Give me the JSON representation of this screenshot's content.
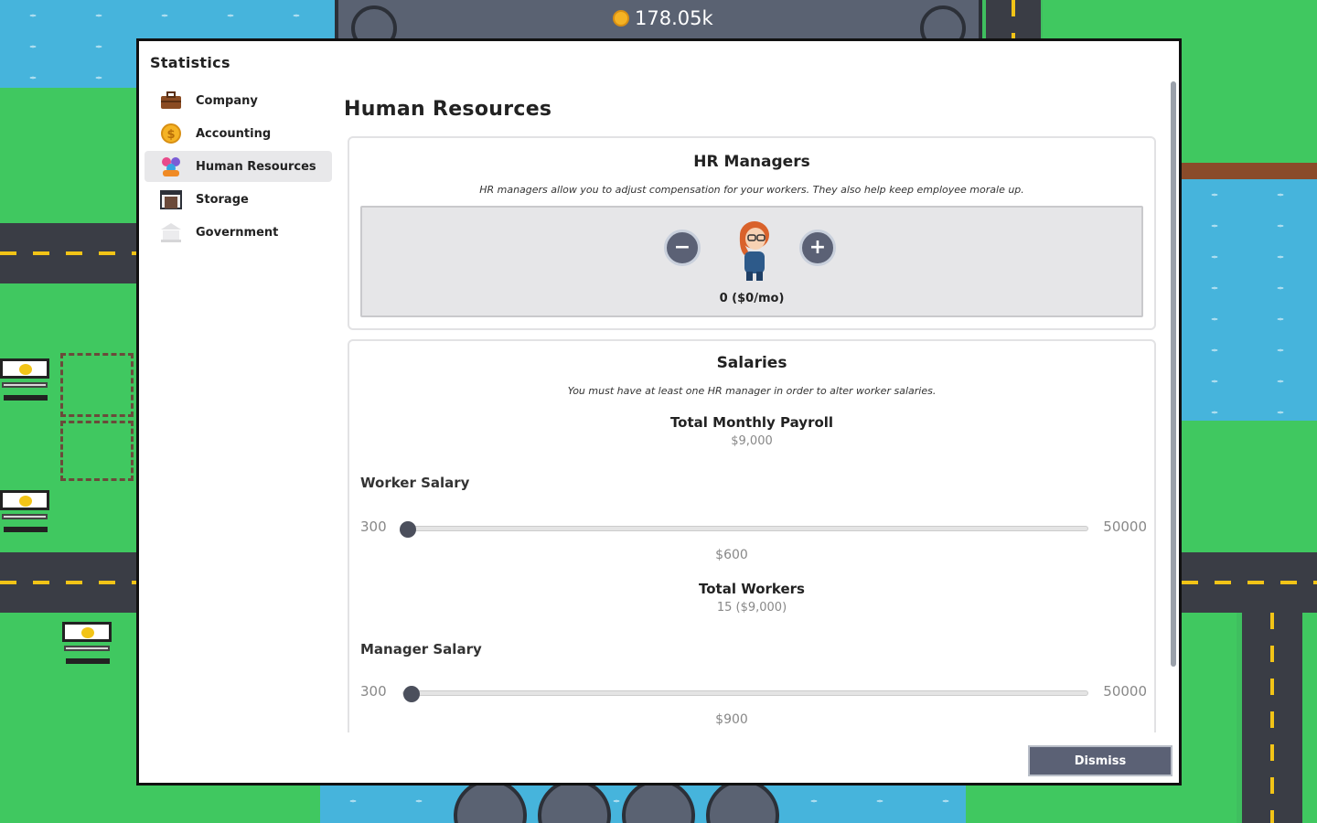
{
  "hud": {
    "money": "178.05k"
  },
  "modal": {
    "title": "Statistics",
    "nav": [
      {
        "label": "Company",
        "icon": "briefcase-icon"
      },
      {
        "label": "Accounting",
        "icon": "coin-icon"
      },
      {
        "label": "Human Resources",
        "icon": "people-icon",
        "active": true
      },
      {
        "label": "Storage",
        "icon": "warehouse-icon"
      },
      {
        "label": "Government",
        "icon": "capitol-icon"
      }
    ],
    "section_title": "Human Resources",
    "hr_managers": {
      "title": "HR Managers",
      "description": "HR managers allow you to adjust compensation for your workers. They also help keep employee morale up.",
      "count_label": "0 ($0/mo)"
    },
    "salaries": {
      "title": "Salaries",
      "description": "You must have at least one HR manager in order to alter worker salaries.",
      "payroll_label": "Total Monthly Payroll",
      "payroll_value": "$9,000",
      "worker_salary": {
        "label": "Worker Salary",
        "min": "300",
        "max": "50000",
        "value": 600,
        "value_label": "$600"
      },
      "workers_label": "Total Workers",
      "workers_value": "15 ($9,000)",
      "manager_salary": {
        "label": "Manager Salary",
        "min": "300",
        "max": "50000",
        "value": 900,
        "value_label": "$900"
      }
    },
    "dismiss_label": "Dismiss"
  },
  "colors": {
    "accent_button": "#5b6175",
    "grass": "#3fc45e",
    "water": "#46b4dc",
    "road": "#3a3d45",
    "road_line": "#f2c417"
  }
}
